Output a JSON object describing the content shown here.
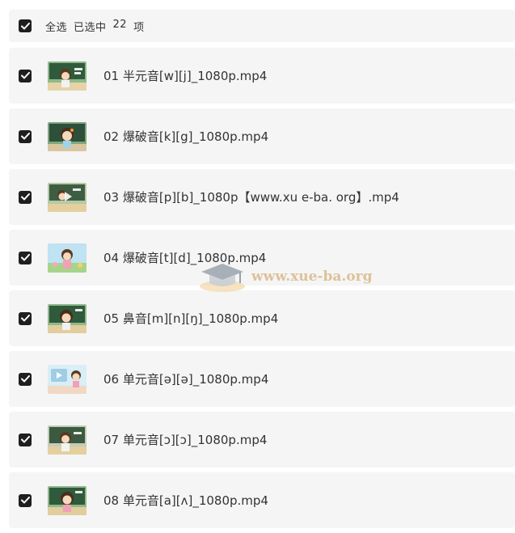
{
  "header": {
    "select_all_label": "全选",
    "selected_prefix": "已选中",
    "selected_count": "22",
    "selected_suffix": "项"
  },
  "files": [
    {
      "name": "01 半元音[w][j]_1080p.mp4",
      "checked": true
    },
    {
      "name": "02 爆破音[k][g]_1080p.mp4",
      "checked": true
    },
    {
      "name": "03 爆破音[p][b]_1080p【www.xu e-ba. org】.mp4",
      "checked": true
    },
    {
      "name": "04 爆破音[t][d]_1080p.mp4",
      "checked": true
    },
    {
      "name": "05 鼻音[m][n][ŋ]_1080p.mp4",
      "checked": true
    },
    {
      "name": "06 单元音[ə][ə]_1080p.mp4",
      "checked": true
    },
    {
      "name": "07 单元音[ɔ][ɔ]_1080p.mp4",
      "checked": true
    },
    {
      "name": "08 单元音[a][ʌ]_1080p.mp4",
      "checked": true
    }
  ],
  "watermark": {
    "text": "www.xue-ba.org"
  },
  "colors": {
    "row_bg": "#f5f5f5",
    "checkbox": "#1f1f1f",
    "watermark": "#d9b98a"
  }
}
